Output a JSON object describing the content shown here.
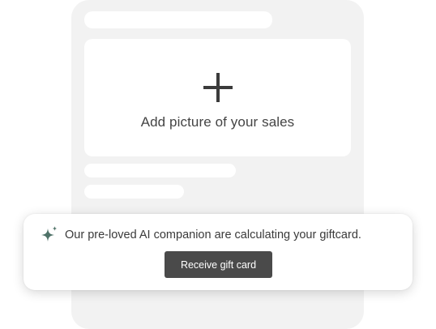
{
  "upload": {
    "label": "Add picture of your sales",
    "icon": "plus-icon"
  },
  "notice": {
    "icon": "sparkle-icon",
    "icon_color": "#4f7268",
    "message": "Our pre-loved AI companion are calculating your giftcard.",
    "button_label": "Receive gift card"
  },
  "colors": {
    "card_background": "#f2f2f2",
    "placeholder": "#ffffff",
    "button": "#4a4a4a",
    "text": "#3a3a3a"
  }
}
